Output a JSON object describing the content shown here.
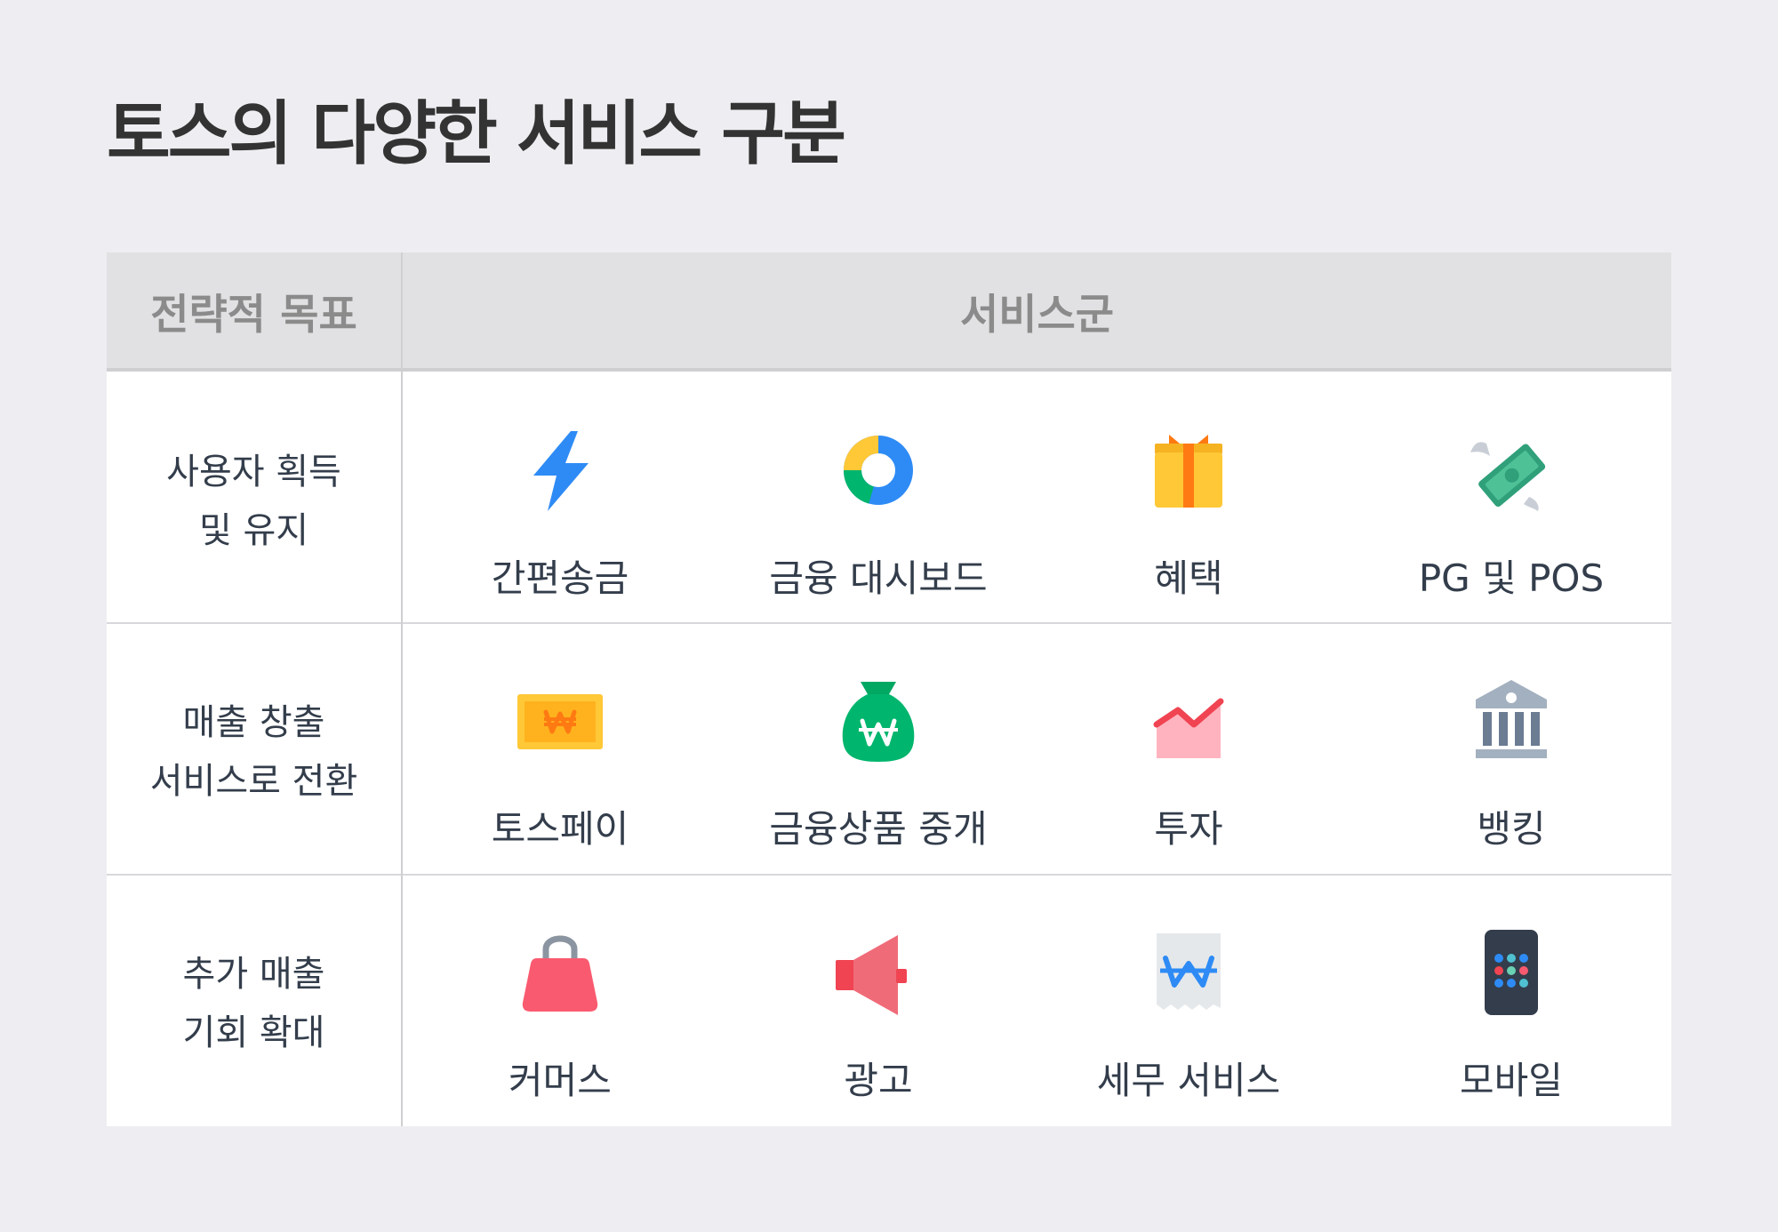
{
  "title": "토스의 다양한 서비스 구분",
  "header": {
    "goal": "전략적 목표",
    "services": "서비스군"
  },
  "rows": [
    {
      "goal_lines": [
        "사용자 획득",
        "및 유지"
      ],
      "services": [
        {
          "label": "간편송금",
          "icon": "lightning-bolt-icon"
        },
        {
          "label": "금융 대시보드",
          "icon": "donut-chart-icon"
        },
        {
          "label": "혜택",
          "icon": "gift-box-icon"
        },
        {
          "label": "PG 및 POS",
          "icon": "winged-money-icon"
        }
      ]
    },
    {
      "goal_lines": [
        "매출 창출",
        "서비스로 전환"
      ],
      "services": [
        {
          "label": "토스페이",
          "icon": "won-bill-icon"
        },
        {
          "label": "금융상품 중개",
          "icon": "money-bag-icon"
        },
        {
          "label": "투자",
          "icon": "rising-chart-icon"
        },
        {
          "label": "뱅킹",
          "icon": "bank-building-icon"
        }
      ]
    },
    {
      "goal_lines": [
        "추가 매출",
        "기회 확대"
      ],
      "services": [
        {
          "label": "커머스",
          "icon": "shopping-bag-icon"
        },
        {
          "label": "광고",
          "icon": "megaphone-icon"
        },
        {
          "label": "세무 서비스",
          "icon": "receipt-icon"
        },
        {
          "label": "모바일",
          "icon": "mobile-phone-icon"
        }
      ]
    }
  ],
  "colors": {
    "page_bg": "#eeeef2",
    "header_bg": "#e1e1e3",
    "header_text": "#8b8b8b",
    "body_text": "#333d4b",
    "blue": "#2e8bf5",
    "green": "#00b56d",
    "yellow": "#ffc837",
    "orange": "#ff7a12",
    "red": "#f04452"
  }
}
